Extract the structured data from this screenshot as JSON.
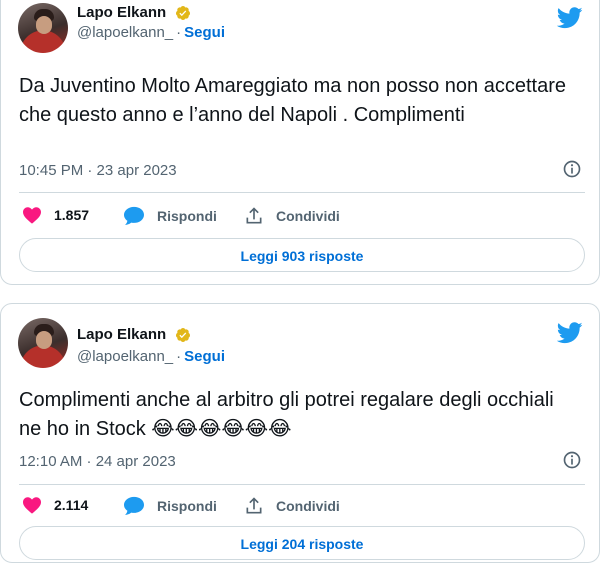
{
  "tweets": [
    {
      "author_name": "Lapo Elkann",
      "handle": "@lapoelkann_",
      "separator": "·",
      "follow_label": "Segui",
      "text": "Da Juventino Molto Amareggiato ma non posso non accettare che questo anno e l’anno del Napoli . Complimenti",
      "timestamp": "10:45 PM · 23 apr 2023",
      "likes": "1.857",
      "reply_label": "Rispondi",
      "share_label": "Condividi",
      "read_replies_label": "Leggi 903 risposte"
    },
    {
      "author_name": "Lapo Elkann",
      "handle": "@lapoelkann_",
      "separator": "·",
      "follow_label": "Segui",
      "text": "Complimenti anche al arbitro gli potrei regalare degli occhiali ne ho in Stock 😂😂😂😂😂😂",
      "timestamp": "12:10 AM · 24 apr 2023",
      "likes": "2.114",
      "reply_label": "Rispondi",
      "share_label": "Condividi",
      "read_replies_label": "Leggi 204 risposte"
    }
  ],
  "colors": {
    "twitter_blue": "#1d9bf0",
    "like_pink": "#f91880",
    "verified_gold": "#e2b719",
    "text_gray": "#536471",
    "link_blue": "#006fd6"
  },
  "icons": [
    "twitter-bird-icon",
    "verified-badge-icon",
    "heart-icon",
    "reply-bubble-icon",
    "share-icon",
    "info-icon"
  ]
}
